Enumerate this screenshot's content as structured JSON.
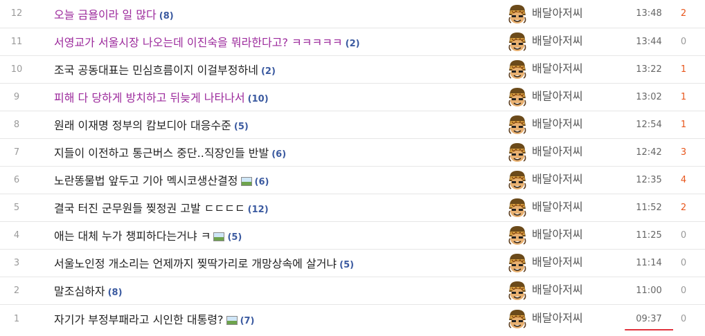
{
  "posts": [
    {
      "num": "12",
      "title": "오늘 금욜이라 일 많다",
      "visited": true,
      "image": false,
      "comments": "(8)",
      "author": "배달아저씨",
      "time": "13:48",
      "rec": "2"
    },
    {
      "num": "11",
      "title": "서영교가 서울시장 나오는데 이진숙을 뭐라한다고? ㅋㅋㅋㅋㅋ",
      "visited": true,
      "image": false,
      "comments": "(2)",
      "author": "배달아저씨",
      "time": "13:44",
      "rec": "0"
    },
    {
      "num": "10",
      "title": "조국 공동대표는 민심흐름이지 이걸부정하네",
      "visited": false,
      "image": false,
      "comments": "(2)",
      "author": "배달아저씨",
      "time": "13:22",
      "rec": "1"
    },
    {
      "num": "9",
      "title": "피해 다 당하게 방치하고 뒤늦게 나타나서",
      "visited": true,
      "image": false,
      "comments": "(10)",
      "author": "배달아저씨",
      "time": "13:02",
      "rec": "1"
    },
    {
      "num": "8",
      "title": "원래 이재명 정부의 캄보디아 대응수준",
      "visited": false,
      "image": false,
      "comments": "(5)",
      "author": "배달아저씨",
      "time": "12:54",
      "rec": "1"
    },
    {
      "num": "7",
      "title": "지들이 이전하고 통근버스 중단..직장인들 반발",
      "visited": false,
      "image": false,
      "comments": "(6)",
      "author": "배달아저씨",
      "time": "12:42",
      "rec": "3"
    },
    {
      "num": "6",
      "title": "노란똥물법 앞두고 기아 멕시코생산결정",
      "visited": false,
      "image": true,
      "comments": "(6)",
      "author": "배달아저씨",
      "time": "12:35",
      "rec": "4"
    },
    {
      "num": "5",
      "title": "결국 터진 군무원들 찢정권 고발 ㄷㄷㄷㄷ",
      "visited": false,
      "image": false,
      "comments": "(12)",
      "author": "배달아저씨",
      "time": "11:52",
      "rec": "2"
    },
    {
      "num": "4",
      "title": "애는 대체 누가 챙피하다는거냐 ㅋ",
      "visited": false,
      "image": true,
      "comments": "(5)",
      "author": "배달아저씨",
      "time": "11:25",
      "rec": "0"
    },
    {
      "num": "3",
      "title": "서울노인정 개소리는 언제까지 찢딱가리로 개망상속에 살거냐",
      "visited": false,
      "image": false,
      "comments": "(5)",
      "author": "배달아저씨",
      "time": "11:14",
      "rec": "0"
    },
    {
      "num": "2",
      "title": "말조심하자",
      "visited": false,
      "image": false,
      "comments": "(8)",
      "author": "배달아저씨",
      "time": "11:00",
      "rec": "0"
    },
    {
      "num": "1",
      "title": "자기가 부정부패라고 시인한 대통령?",
      "visited": false,
      "image": true,
      "comments": "(7)",
      "author": "배달아저씨",
      "time": "09:37",
      "rec": "0",
      "marked": true
    }
  ],
  "colors": {
    "visited": "#9c2a9c",
    "comment": "#3b5aa0",
    "recommend_hot": "#e8561c",
    "annotation": "#e0323c"
  },
  "icons": {
    "avatar": "avatar-icon",
    "image": "image-attachment-icon"
  }
}
